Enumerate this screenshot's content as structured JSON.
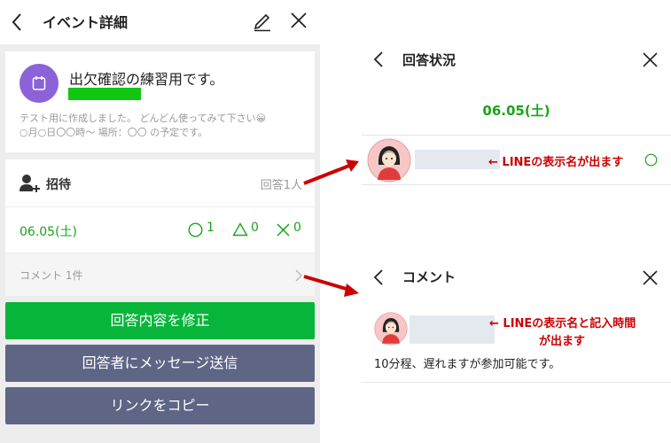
{
  "left": {
    "header": {
      "title": "イベント詳細",
      "back_icon": "chevron-left-icon",
      "edit_icon": "pencil-icon",
      "close_icon": "close-icon"
    },
    "event": {
      "title": "出欠確認の練習用です。",
      "description_line1": "テスト用に作成しました。 どんどん使ってみて下さい😀",
      "description_line2": "○月○日〇〇時〜 場所：〇〇 の予定です。",
      "accent_color": "#8c62d8"
    },
    "invite": {
      "label": "招待",
      "response_count": "回答1人",
      "icon": "add-person-icon"
    },
    "date_row": {
      "date": "06.05(土)",
      "yes_count": "1",
      "maybe_count": "0",
      "no_count": "0"
    },
    "comment_row": {
      "label": "コメント 1件",
      "icon": "chevron-right-icon"
    },
    "buttons": {
      "edit_answer": "回答内容を修正",
      "message": "回答者にメッセージ送信",
      "copy_link": "リンクをコピー"
    }
  },
  "status_panel": {
    "title": "回答状況",
    "date": "06.05(土)",
    "annotation": "← LINEの表示名が出ます"
  },
  "comment_panel": {
    "title": "コメント",
    "annotation_line1": "← LINEの表示名と記入時間",
    "annotation_line2": "が出ます",
    "comment_text": "10分程、遅れますが参加可能です。"
  },
  "colors": {
    "line_green": "#07b53b",
    "gray_button": "#5e6585",
    "annotation_red": "#cc0000"
  }
}
